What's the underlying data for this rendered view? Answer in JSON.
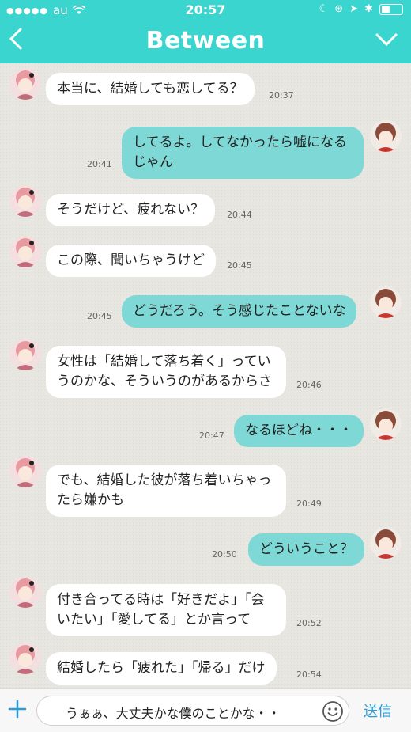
{
  "status": {
    "carrier": "au",
    "time": "20:57"
  },
  "header": {
    "title": "Between"
  },
  "messages": [
    {
      "text": "本当に、結婚しても恋してる？",
      "time": "20:37"
    },
    {
      "text": "してるよ。してなかったら嘘になるじゃん",
      "time": "20:41"
    },
    {
      "text": "そうだけど、疲れない？",
      "time": "20:44"
    },
    {
      "text": "この際、聞いちゃうけど",
      "time": "20:45"
    },
    {
      "text": "どうだろう。そう感じたことないな",
      "time": "20:45"
    },
    {
      "text": "女性は「結婚して落ち着く」っていうのかな、そういうのがあるからさ",
      "time": "20:46"
    },
    {
      "text": "なるほどね・・・",
      "time": "20:47"
    },
    {
      "text": "でも、結婚した彼が落ち着いちゃったら嫌かも",
      "time": "20:49"
    },
    {
      "text": "どういうこと？",
      "time": "20:50"
    },
    {
      "text": "付き合ってる時は「好きだよ」「会いたい」「愛してる」とか言って",
      "time": "20:52"
    },
    {
      "text": "結婚したら「疲れた」「帰る」だけ",
      "time": "20:54"
    }
  ],
  "composer": {
    "text": "うぁぁ、大丈夫かな僕のことかな・・",
    "send_label": "送信"
  },
  "colors": {
    "header": "#3bd5cf",
    "outgoing_bubble": "#7dd8d6",
    "incoming_bubble": "#ffffff",
    "accent": "#2a9dd6"
  },
  "icons": [
    "back-icon",
    "menu-chevron-icon",
    "plus-icon",
    "emoji-icon",
    "wifi-icon",
    "battery-icon"
  ]
}
